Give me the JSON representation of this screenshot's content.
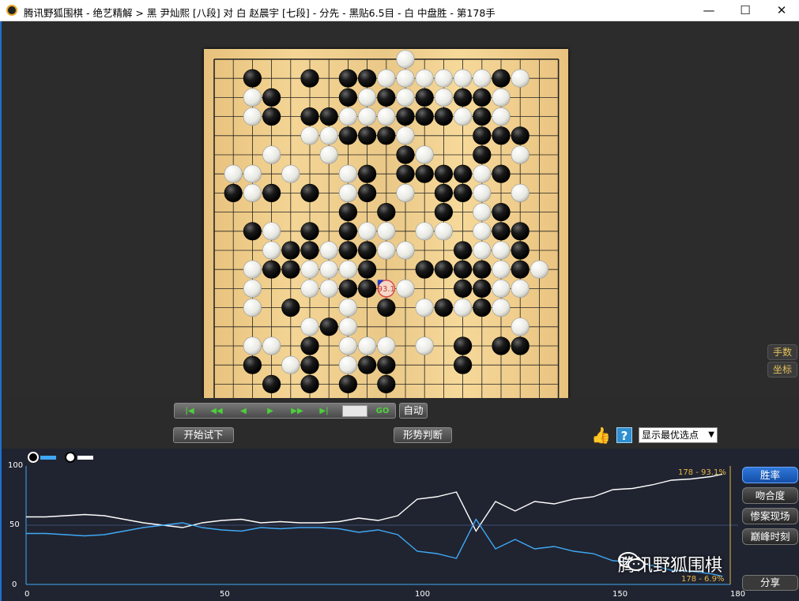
{
  "window": {
    "title": "腾讯野狐围棋 - 绝艺精解 > 黑 尹灿熙 [八段] 对 白 赵晨宇 [七段] - 分先 - 黑贴6.5目 - 白 中盘胜 - 第178手",
    "minimize": "—",
    "maximize": "☐",
    "close": "✕"
  },
  "board": {
    "size": 19,
    "black": [
      [
        2,
        1
      ],
      [
        5,
        1
      ],
      [
        3,
        2
      ],
      [
        7,
        1
      ],
      [
        8,
        1
      ],
      [
        15,
        1
      ],
      [
        7,
        2
      ],
      [
        9,
        2
      ],
      [
        11,
        2
      ],
      [
        13,
        2
      ],
      [
        14,
        2
      ],
      [
        3,
        3
      ],
      [
        5,
        3
      ],
      [
        6,
        3
      ],
      [
        10,
        3
      ],
      [
        11,
        3
      ],
      [
        12,
        3
      ],
      [
        14,
        3
      ],
      [
        7,
        4
      ],
      [
        8,
        4
      ],
      [
        9,
        4
      ],
      [
        14,
        4
      ],
      [
        15,
        4
      ],
      [
        16,
        4
      ],
      [
        10,
        5
      ],
      [
        14,
        5
      ],
      [
        8,
        6
      ],
      [
        10,
        6
      ],
      [
        11,
        6
      ],
      [
        12,
        6
      ],
      [
        13,
        6
      ],
      [
        15,
        6
      ],
      [
        1,
        7
      ],
      [
        3,
        7
      ],
      [
        5,
        7
      ],
      [
        8,
        7
      ],
      [
        12,
        7
      ],
      [
        13,
        7
      ],
      [
        7,
        8
      ],
      [
        9,
        8
      ],
      [
        12,
        8
      ],
      [
        15,
        8
      ],
      [
        2,
        9
      ],
      [
        5,
        9
      ],
      [
        7,
        9
      ],
      [
        15,
        9
      ],
      [
        16,
        9
      ],
      [
        4,
        10
      ],
      [
        5,
        10
      ],
      [
        7,
        10
      ],
      [
        8,
        10
      ],
      [
        13,
        10
      ],
      [
        16,
        10
      ],
      [
        3,
        11
      ],
      [
        4,
        11
      ],
      [
        8,
        11
      ],
      [
        11,
        11
      ],
      [
        12,
        11
      ],
      [
        13,
        11
      ],
      [
        14,
        11
      ],
      [
        16,
        11
      ],
      [
        7,
        12
      ],
      [
        8,
        12
      ],
      [
        13,
        12
      ],
      [
        14,
        12
      ],
      [
        4,
        13
      ],
      [
        9,
        13
      ],
      [
        12,
        13
      ],
      [
        14,
        13
      ],
      [
        6,
        14
      ],
      [
        5,
        15
      ],
      [
        13,
        15
      ],
      [
        15,
        15
      ],
      [
        16,
        15
      ],
      [
        2,
        16
      ],
      [
        5,
        16
      ],
      [
        8,
        16
      ],
      [
        9,
        16
      ],
      [
        13,
        16
      ],
      [
        3,
        17
      ],
      [
        5,
        17
      ],
      [
        7,
        17
      ],
      [
        9,
        17
      ]
    ],
    "white": [
      [
        10,
        0
      ],
      [
        2,
        1
      ],
      [
        9,
        1
      ],
      [
        10,
        1
      ],
      [
        11,
        1
      ],
      [
        12,
        1
      ],
      [
        13,
        1
      ],
      [
        14,
        1
      ],
      [
        16,
        1
      ],
      [
        2,
        2
      ],
      [
        8,
        2
      ],
      [
        10,
        2
      ],
      [
        12,
        2
      ],
      [
        13,
        2
      ],
      [
        15,
        2
      ],
      [
        2,
        3
      ],
      [
        7,
        3
      ],
      [
        8,
        3
      ],
      [
        9,
        3
      ],
      [
        13,
        3
      ],
      [
        15,
        3
      ],
      [
        5,
        4
      ],
      [
        6,
        4
      ],
      [
        10,
        4
      ],
      [
        16,
        5
      ],
      [
        3,
        5
      ],
      [
        6,
        5
      ],
      [
        11,
        5
      ],
      [
        1,
        6
      ],
      [
        2,
        6
      ],
      [
        4,
        6
      ],
      [
        7,
        6
      ],
      [
        14,
        6
      ],
      [
        2,
        7
      ],
      [
        7,
        7
      ],
      [
        10,
        7
      ],
      [
        13,
        7
      ],
      [
        14,
        7
      ],
      [
        16,
        7
      ],
      [
        7,
        8
      ],
      [
        12,
        8
      ],
      [
        14,
        8
      ],
      [
        8,
        9
      ],
      [
        9,
        9
      ],
      [
        3,
        9
      ],
      [
        11,
        9
      ],
      [
        12,
        9
      ],
      [
        14,
        9
      ],
      [
        15,
        9
      ],
      [
        3,
        10
      ],
      [
        6,
        10
      ],
      [
        9,
        10
      ],
      [
        10,
        10
      ],
      [
        14,
        10
      ],
      [
        15,
        10
      ],
      [
        2,
        11
      ],
      [
        5,
        11
      ],
      [
        6,
        11
      ],
      [
        7,
        11
      ],
      [
        15,
        11
      ],
      [
        17,
        11
      ],
      [
        2,
        12
      ],
      [
        5,
        12
      ],
      [
        6,
        12
      ],
      [
        10,
        12
      ],
      [
        15,
        12
      ],
      [
        16,
        12
      ],
      [
        2,
        13
      ],
      [
        7,
        13
      ],
      [
        11,
        13
      ],
      [
        13,
        13
      ],
      [
        15,
        13
      ],
      [
        5,
        14
      ],
      [
        7,
        14
      ],
      [
        16,
        14
      ],
      [
        2,
        15
      ],
      [
        3,
        15
      ],
      [
        7,
        15
      ],
      [
        8,
        15
      ],
      [
        9,
        15
      ],
      [
        11,
        15
      ],
      [
        4,
        16
      ],
      [
        7,
        16
      ]
    ],
    "last_move": [
      9,
      12
    ],
    "hint_label": "93.1"
  },
  "side_buttons": {
    "moves": "手数",
    "coords": "坐标"
  },
  "controls": {
    "nav": [
      "|◀",
      "◀◀",
      "◀",
      "▶",
      "▶▶",
      "▶|"
    ],
    "go": "GO",
    "auto": "自动",
    "start_trial": "开始试下",
    "judge": "形势判断",
    "help": "?",
    "select_value": "显示最优选点",
    "select_arrow": "▼",
    "thumb": "👍"
  },
  "chart_data": {
    "type": "line",
    "x": [
      0,
      5,
      10,
      15,
      20,
      25,
      30,
      35,
      40,
      45,
      50,
      55,
      60,
      65,
      70,
      75,
      80,
      85,
      90,
      95,
      100,
      105,
      110,
      115,
      120,
      125,
      130,
      135,
      140,
      145,
      150,
      155,
      160,
      165,
      170,
      175,
      178
    ],
    "series": [
      {
        "color": "#ffffff",
        "values": [
          57,
          57,
          58,
          59,
          58,
          55,
          52,
          50,
          48,
          52,
          54,
          55,
          52,
          53,
          52,
          52,
          53,
          56,
          54,
          58,
          72,
          74,
          78,
          45,
          70,
          62,
          70,
          68,
          72,
          74,
          80,
          81,
          84,
          88,
          89,
          91,
          93.1
        ]
      },
      {
        "color": "#3fa9f5",
        "values": [
          43,
          43,
          42,
          41,
          42,
          45,
          48,
          50,
          52,
          48,
          46,
          45,
          48,
          47,
          48,
          48,
          47,
          44,
          46,
          42,
          28,
          26,
          22,
          55,
          30,
          38,
          30,
          32,
          28,
          26,
          20,
          19,
          16,
          12,
          11,
          9,
          6.9
        ]
      }
    ],
    "xlim": [
      0,
      180
    ],
    "ylim": [
      0,
      100
    ],
    "x_ticks": [
      "0",
      "50",
      "100",
      "150",
      "180"
    ],
    "y_ticks": [
      "100",
      "50",
      "0"
    ],
    "top_label": "178 - 93.1%",
    "bottom_label": "178 - 6.9%"
  },
  "chart_buttons": [
    "胜率",
    "吻合度",
    "惨案现场",
    "巅峰时刻"
  ],
  "share": "分享",
  "watermark": "腾讯野狐围棋"
}
